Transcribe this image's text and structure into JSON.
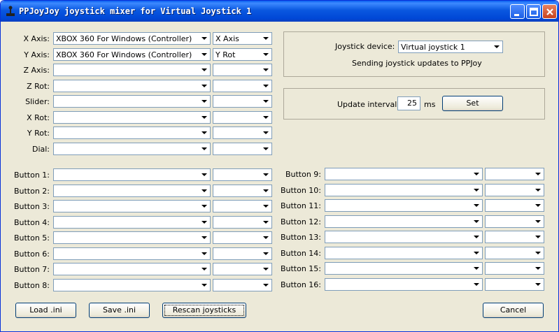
{
  "window": {
    "title": "PPJoyJoy joystick mixer for Virtual Joystick 1"
  },
  "axes": [
    {
      "label": "X Axis:",
      "source": "XBOX 360 For Windows (Controller)",
      "target": "X Axis"
    },
    {
      "label": "Y Axis:",
      "source": "XBOX 360 For Windows (Controller)",
      "target": "Y Rot"
    },
    {
      "label": "Z Axis:",
      "source": "",
      "target": ""
    },
    {
      "label": "Z Rot:",
      "source": "",
      "target": ""
    },
    {
      "label": "Slider:",
      "source": "",
      "target": ""
    },
    {
      "label": "X Rot:",
      "source": "",
      "target": ""
    },
    {
      "label": "Y Rot:",
      "source": "",
      "target": ""
    },
    {
      "label": "Dial:",
      "source": "",
      "target": ""
    }
  ],
  "buttons_left": [
    {
      "label": "Button 1:",
      "source": "",
      "target": ""
    },
    {
      "label": "Button 2:",
      "source": "",
      "target": ""
    },
    {
      "label": "Button 3:",
      "source": "",
      "target": ""
    },
    {
      "label": "Button 4:",
      "source": "",
      "target": ""
    },
    {
      "label": "Button 5:",
      "source": "",
      "target": ""
    },
    {
      "label": "Button 6:",
      "source": "",
      "target": ""
    },
    {
      "label": "Button 7:",
      "source": "",
      "target": ""
    },
    {
      "label": "Button 8:",
      "source": "",
      "target": ""
    }
  ],
  "buttons_right": [
    {
      "label": "Button 9:",
      "source": "",
      "target": ""
    },
    {
      "label": "Button 10:",
      "source": "",
      "target": ""
    },
    {
      "label": "Button 11:",
      "source": "",
      "target": ""
    },
    {
      "label": "Button 12:",
      "source": "",
      "target": ""
    },
    {
      "label": "Button 13:",
      "source": "",
      "target": ""
    },
    {
      "label": "Button 14:",
      "source": "",
      "target": ""
    },
    {
      "label": "Button 15:",
      "source": "",
      "target": ""
    },
    {
      "label": "Button 16:",
      "source": "",
      "target": ""
    }
  ],
  "device_group": {
    "label": "Joystick device:",
    "device": "Virtual joystick 1",
    "status": "Sending joystick updates to PPJoy"
  },
  "interval_group": {
    "label": "Update interval:",
    "value": "25",
    "unit": "ms",
    "set_label": "Set"
  },
  "footer": {
    "load_label": "Load .ini",
    "save_label": "Save .ini",
    "rescan_label": "Rescan joysticks",
    "cancel_label": "Cancel"
  },
  "colors": {
    "titlebar": "#0a58e0",
    "window_bg": "#ece9d8",
    "border": "#7f9db9"
  }
}
